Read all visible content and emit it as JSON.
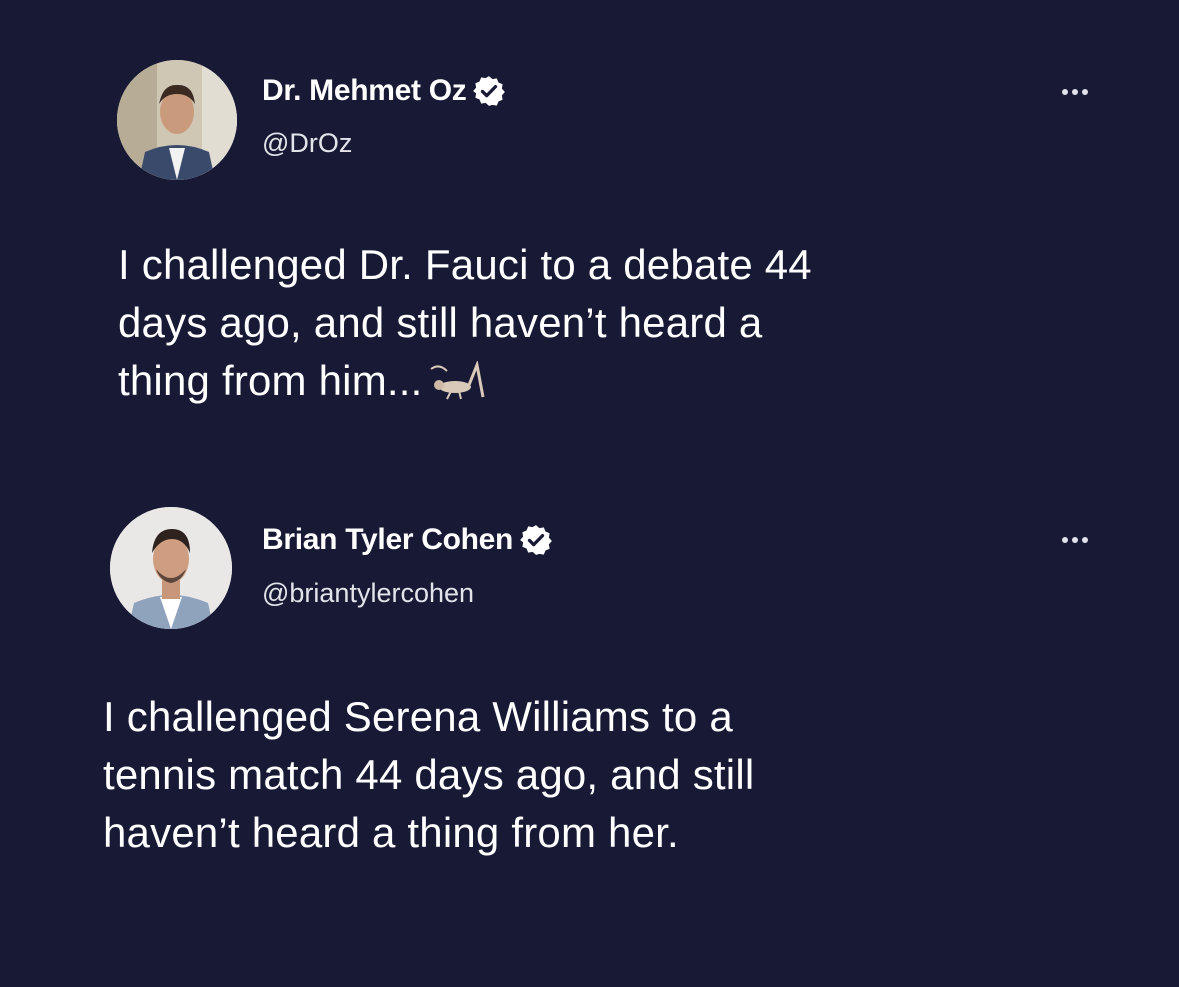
{
  "tweets": [
    {
      "display_name": "Dr. Mehmet Oz",
      "handle": "@DrOz",
      "verified": true,
      "avatar_icon": "avatar-photo",
      "more_icon": "more-horizontal-icon",
      "body_lines": [
        "I challenged Dr. Fauci to a debate 44",
        "days ago, and still haven’t heard a",
        "thing from him..."
      ],
      "emoji": "cricket"
    },
    {
      "display_name": "Brian Tyler Cohen",
      "handle": "@briantylercohen",
      "verified": true,
      "avatar_icon": "avatar-photo",
      "more_icon": "more-horizontal-icon",
      "body_lines": [
        "I challenged Serena Williams to a",
        "tennis match 44 days ago, and still",
        "haven’t heard a thing from her."
      ]
    }
  ],
  "colors": {
    "background": "#171935",
    "text": "#ffffff",
    "verified_badge": "#ffffff"
  }
}
